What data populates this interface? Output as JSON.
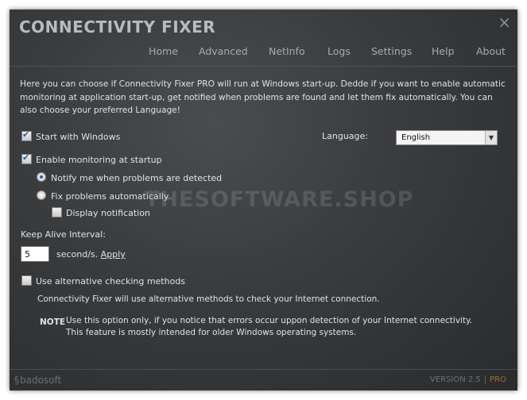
{
  "window": {
    "title": "CONNECTIVITY FIXER",
    "close_icon": "×"
  },
  "nav": {
    "items": [
      "Home",
      "Advanced",
      "NetInfo",
      "Logs",
      "Settings",
      "Help",
      "About"
    ]
  },
  "intro_text": "Here you can choose if Connectivity Fixer PRO will run at Windows start-up. Dedde if you want to enable automatic monitoring at application start-up, get notified when problems are found and let them fix automatically. You can also choose your preferred Language!",
  "settings": {
    "start_with_windows": {
      "label": "Start with Windows",
      "checked": true
    },
    "language": {
      "label": "Language:",
      "selected": "English"
    },
    "enable_monitoring": {
      "label": "Enable monitoring at startup",
      "checked": true
    },
    "notify_option": {
      "label": "Notify me when problems are detected",
      "selected": true
    },
    "fix_option": {
      "label": "Fix problems automatically",
      "selected": false
    },
    "display_notification": {
      "label": "Display notification",
      "checked": false
    },
    "keep_alive": {
      "label": "Keep Alive Interval:",
      "value": "5",
      "unit": "second/s.",
      "apply_label": "Apply"
    },
    "alt_methods": {
      "label": "Use alternative checking methods",
      "checked": false,
      "description": "Connectivity Fixer will use alternative methods to check your Internet connection."
    },
    "note": {
      "label": "NOTE",
      "text": "Use this option only, if you notice that errors occur uppon detection of your Internet connectivity. This feature is mostly intended for older Windows operating systems."
    }
  },
  "watermark": "THESOFTWARE.SHOP",
  "footer": {
    "brand": "badosoft",
    "version": "VERSION 2.5",
    "separator": "|",
    "edition": "PRO"
  },
  "colors": {
    "accent_pro": "#a3702a",
    "check_blue": "#1e5fae"
  }
}
